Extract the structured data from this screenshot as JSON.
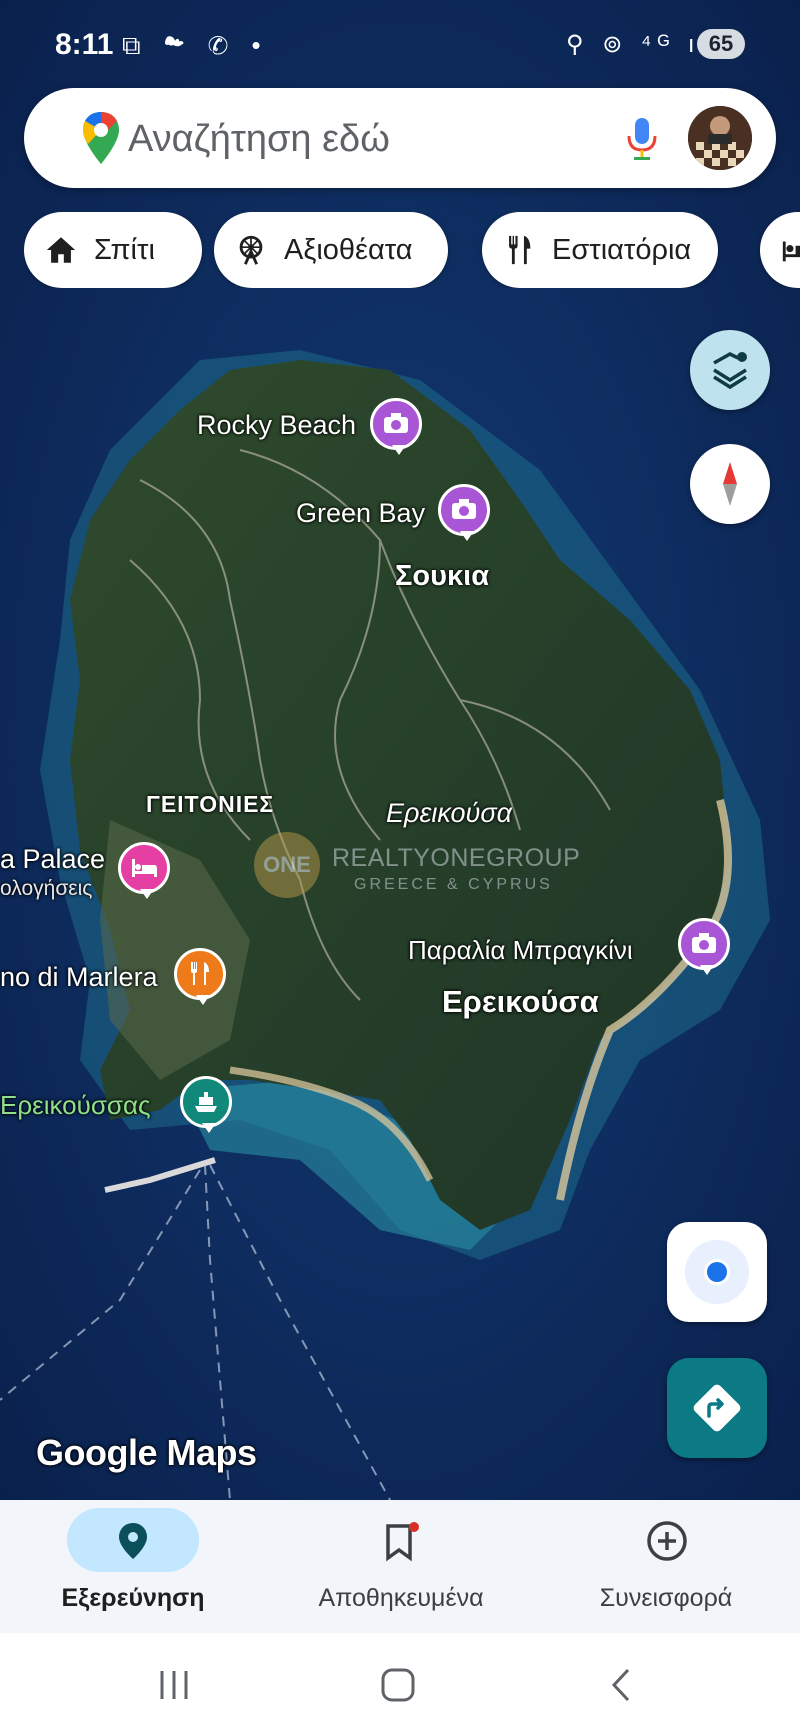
{
  "status_bar": {
    "time": "8:11",
    "left_icons": "⧉ ☁ ✆ •",
    "right_icons": "⚲ ⊚ ⁴ᴳ ıll",
    "battery": "65"
  },
  "search": {
    "placeholder": "Αναζήτηση εδώ"
  },
  "chips": [
    {
      "label": "Σπίτι",
      "icon": "home-icon"
    },
    {
      "label": "Αξιοθέατα",
      "icon": "ferris-wheel-icon"
    },
    {
      "label": "Εστιατόρια",
      "icon": "restaurant-icon"
    }
  ],
  "map": {
    "labels": {
      "rocky_beach": "Rocky Beach",
      "green_bay": "Green Bay",
      "soukia": "Σουκια",
      "geitonies": "ΓΕΙΤΟΝΙΕΣ",
      "ereikousa_italic": "Ερεικούσα",
      "palace": "a Palace",
      "palace_sub": "ολογήσεις",
      "marlera": "no di Marlera",
      "bragkini": "Παραλία Μπραγκίνι",
      "ereikousa_big": "Ερεικούσα",
      "port": "Ερεικούσσας"
    },
    "watermark": {
      "logo": "ONE",
      "line1": "REALTYONEGROUP",
      "line2": "GREECE & CYPRUS"
    },
    "attribution": "Google Maps"
  },
  "colors": {
    "attraction_pin": "#a855d6",
    "hotel_pin": "#e63fa3",
    "restaurant_pin": "#ef7a1a",
    "ferry_pin": "#10897a",
    "accent": "#0b7a85",
    "nav_active_pill": "#c2e7ff"
  },
  "bottom_nav": {
    "explore": "Εξερεύνηση",
    "saved": "Αποθηκευμένα",
    "contribute": "Συνεισφορά"
  }
}
